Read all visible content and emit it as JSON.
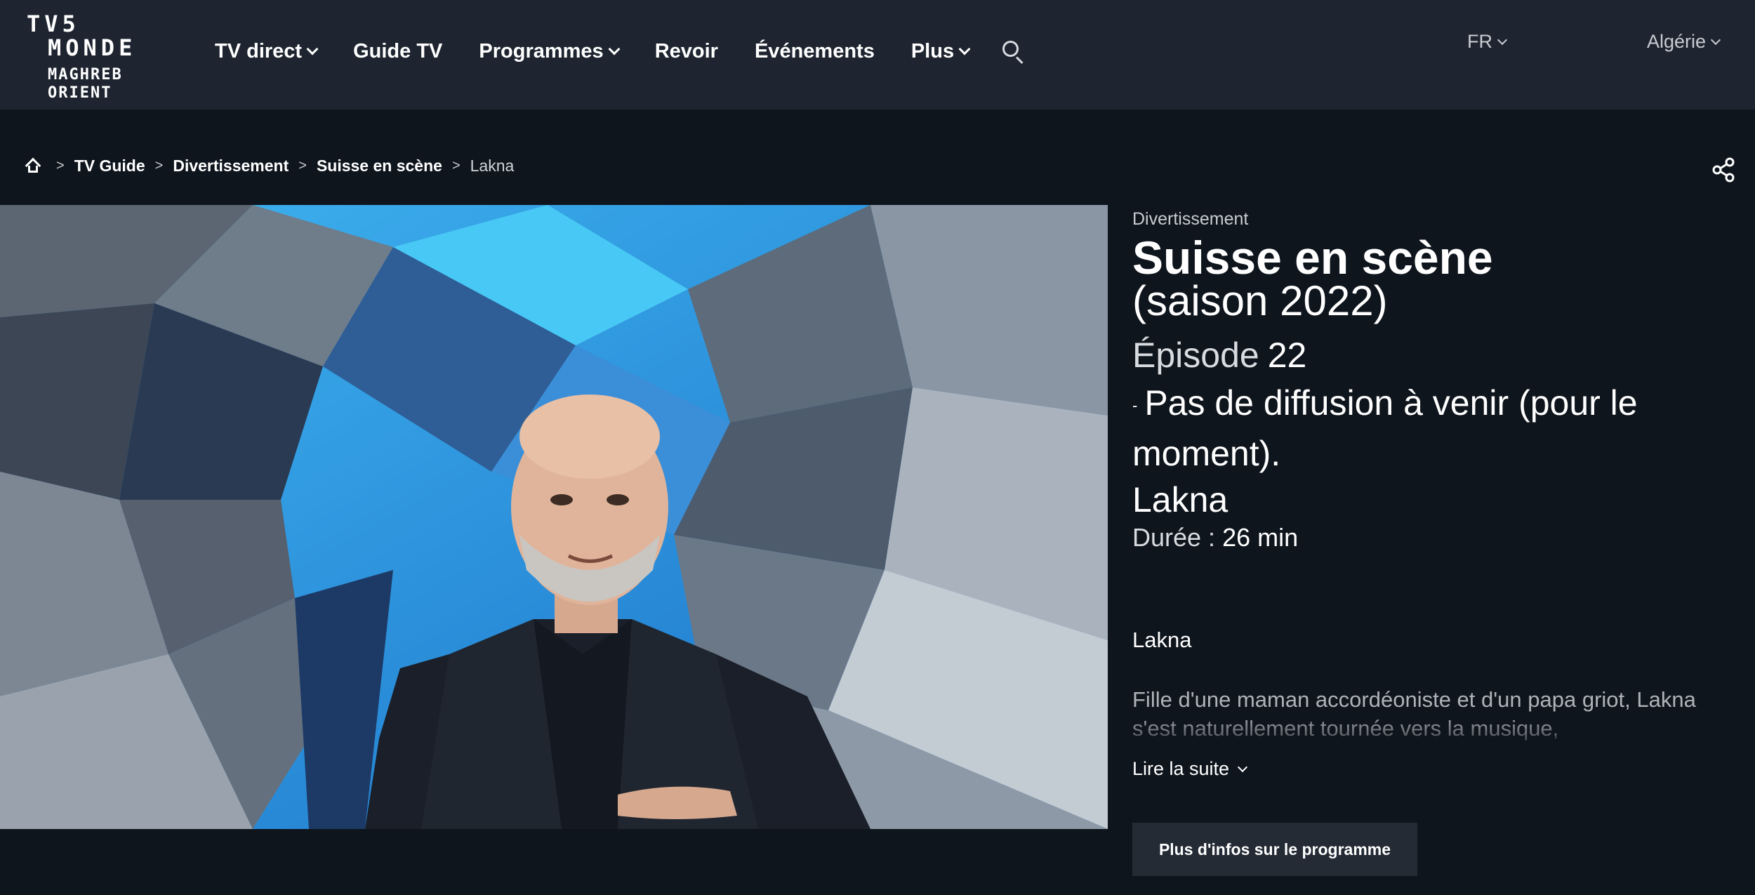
{
  "logo": {
    "line1": "TV5",
    "line2": "MONDE",
    "line3": "MAGHREB",
    "line4": "ORIENT"
  },
  "nav": {
    "items": [
      {
        "label": "TV direct",
        "dropdown": true
      },
      {
        "label": "Guide TV",
        "dropdown": false
      },
      {
        "label": "Programmes",
        "dropdown": true
      },
      {
        "label": "Revoir",
        "dropdown": false
      },
      {
        "label": "Événements",
        "dropdown": false
      },
      {
        "label": "Plus",
        "dropdown": true
      }
    ],
    "search_icon": "search-icon"
  },
  "header_right": {
    "language": "FR",
    "region": "Algérie"
  },
  "breadcrumb": {
    "home_icon": "home-icon",
    "separator": ">",
    "items": [
      "TV Guide",
      "Divertissement",
      "Suisse en scène"
    ],
    "current": "Lakna"
  },
  "share_icon": "share-icon",
  "program": {
    "category": "Divertissement",
    "title": "Suisse en scène",
    "season": "(saison 2022)",
    "episode_label": "Épisode",
    "episode_number": "22",
    "broadcast_dash": "-",
    "broadcast_text": "Pas de diffusion à venir (pour le moment).",
    "episode_title": "Lakna",
    "duration_label": "Durée :",
    "duration_value": "26 min",
    "description_title": "Lakna",
    "description": "Fille d'une maman accordéoniste et d'un papa griot, Lakna s'est naturellement tournée vers la musique,",
    "read_more": "Lire la suite",
    "more_info_button": "Plus d'infos sur le programme"
  },
  "colors": {
    "header_bg": "#1e2530",
    "page_bg": "#0f151d",
    "button_bg": "#242b35",
    "muted_text": "#c8ccd2"
  }
}
